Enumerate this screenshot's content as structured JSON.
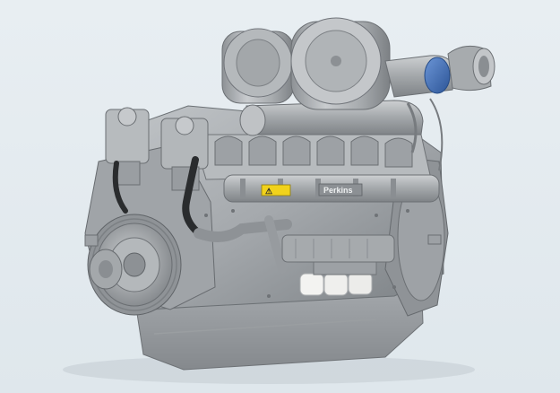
{
  "product": {
    "brand_plate_text": "Perkins",
    "warning_label_text": "⚠"
  },
  "colors": {
    "background": "#e4ebf0",
    "engine_body": "#a9adb0",
    "engine_shadow": "#7d8286",
    "engine_highlight": "#d3d6d8",
    "turbo_accent": "#3f6fb8",
    "warning_label": "#f1d21c",
    "filter_white": "#f3f3f1"
  }
}
